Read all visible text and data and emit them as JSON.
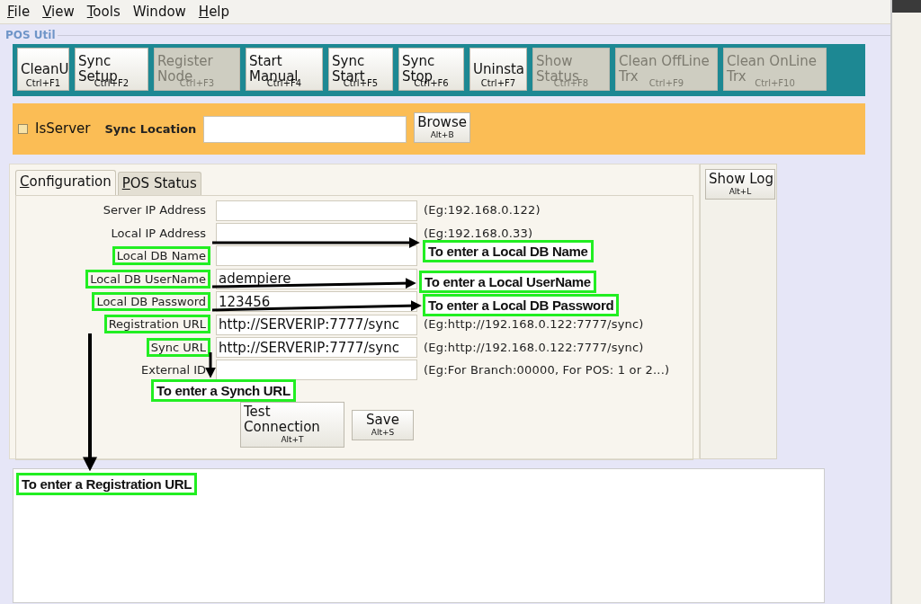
{
  "menu": [
    {
      "label": "File",
      "underlined": true
    },
    {
      "label": "View",
      "underlined": true
    },
    {
      "label": "Tools",
      "underlined": true
    },
    {
      "label": "Window",
      "underlined": false
    },
    {
      "label": "Help",
      "underlined": true
    }
  ],
  "panel_title": "POS Util",
  "toolbar": [
    {
      "label": "CleanU",
      "shortcut": "Ctrl+F1",
      "disabled": false
    },
    {
      "label": "Sync Setup",
      "shortcut": "Ctrl+F2",
      "disabled": false
    },
    {
      "label": "Register Node",
      "shortcut": "Ctrl+F3",
      "disabled": true
    },
    {
      "label": "Start Manual",
      "shortcut": "Ctrl+F4",
      "disabled": false
    },
    {
      "label": "Sync Start",
      "shortcut": "Ctrl+F5",
      "disabled": false
    },
    {
      "label": "Sync Stop",
      "shortcut": "Ctrl+F6",
      "disabled": false
    },
    {
      "label": "Uninsta",
      "shortcut": "Ctrl+F7",
      "disabled": false
    },
    {
      "label": "Show Status",
      "shortcut": "Ctrl+F8",
      "disabled": true
    },
    {
      "label": "Clean OffLine Trx",
      "shortcut": "Ctrl+F9",
      "disabled": true
    },
    {
      "label": "Clean OnLine Trx",
      "shortcut": "Ctrl+F10",
      "disabled": true
    }
  ],
  "server_bar": {
    "isserver": {
      "label": "IsServer",
      "checked": false
    },
    "sync_location_label": "Sync Location",
    "browse": {
      "label": "Browse",
      "shortcut": "Alt+B"
    }
  },
  "tabs": [
    {
      "label": "Configuration",
      "selected": true
    },
    {
      "label": "POS Status",
      "selected": false
    }
  ],
  "form": [
    {
      "label": "Server IP Address",
      "hint": "(Eg:192.168.0.122)",
      "highlighted": false
    },
    {
      "label": "Local IP Address",
      "hint": "(Eg:192.168.0.33)",
      "highlighted": false
    },
    {
      "label": "Local DB Name",
      "highlighted": true
    },
    {
      "label": "Local DB UserName",
      "value": "adempiere",
      "highlighted": true
    },
    {
      "label": "Local DB Password",
      "value": "123456",
      "highlighted": true
    },
    {
      "label": "Registration URL",
      "value": "http://SERVERIP:7777/sync",
      "hint": "(Eg:http://192.168.0.122:7777/sync)",
      "highlighted": true
    },
    {
      "label": "Sync URL",
      "value": "http://SERVERIP:7777/sync",
      "hint": "(Eg:http://192.168.0.122:7777/sync)",
      "highlighted": true
    },
    {
      "label": "External ID",
      "hint": "(Eg:For Branch:00000, For POS: 1 or 2...)",
      "highlighted": false
    }
  ],
  "actions": [
    {
      "label": "Test Connection",
      "shortcut": "Alt+T"
    },
    {
      "label": "Save",
      "shortcut": "Alt+S"
    }
  ],
  "show_log": {
    "label": "Show Log",
    "shortcut": "Alt+L"
  },
  "annotations": [
    {
      "text": "To enter a Local DB Name"
    },
    {
      "text": "To enter a Local UserName"
    },
    {
      "text": "To enter a Local DB Password"
    },
    {
      "text": "To enter a Synch URL"
    },
    {
      "text": "To enter a Registration URL"
    }
  ]
}
